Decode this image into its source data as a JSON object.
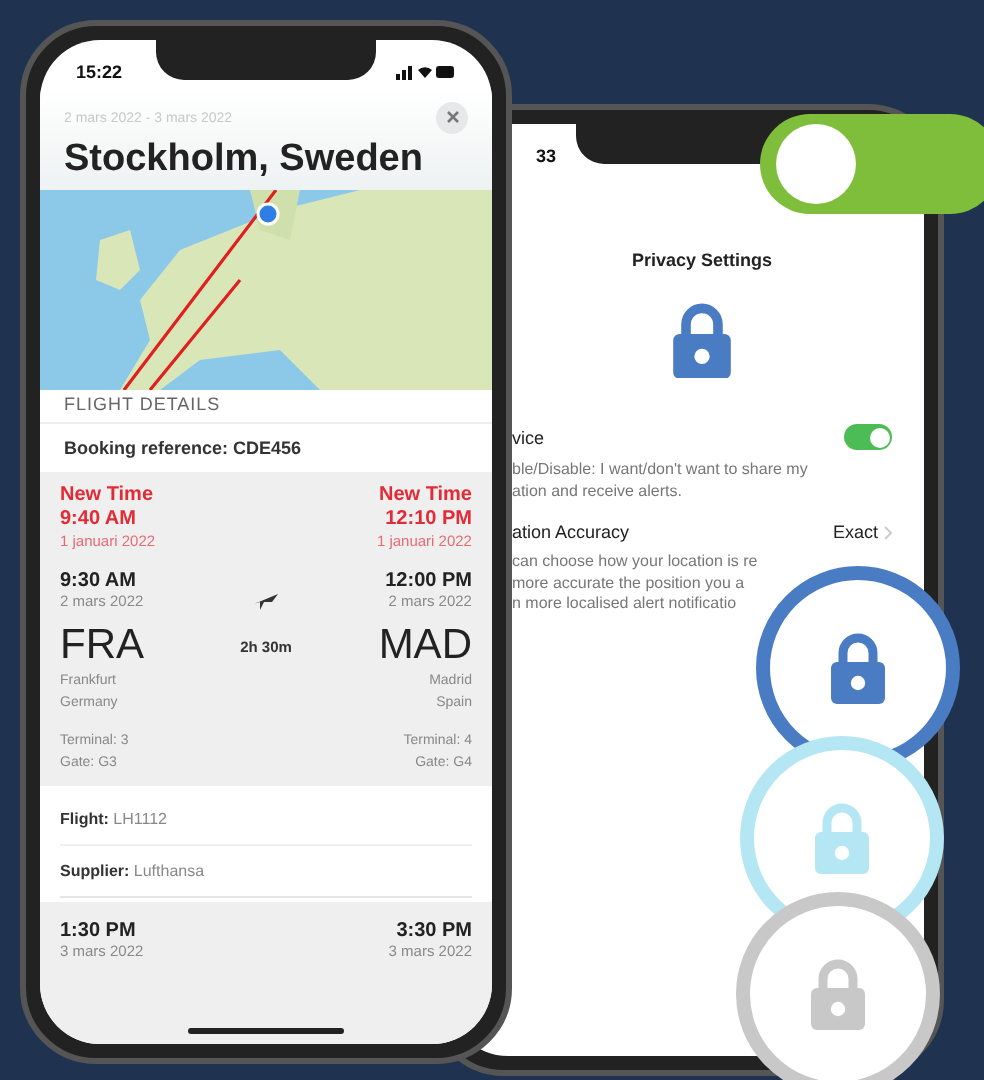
{
  "flight_screen": {
    "status_time": "15:22",
    "date_range": "2 mars 2022 - 3 mars 2022",
    "title": "Stockholm, Sweden",
    "section_title": "FLIGHT DETAILS",
    "booking_reference": "Booking reference: CDE456",
    "departure": {
      "new_time_label": "New Time",
      "new_time": "9:40 AM",
      "new_date": "1 januari 2022",
      "time": "9:30 AM",
      "date": "2 mars 2022",
      "code": "FRA",
      "city": "Frankfurt",
      "country": "Germany",
      "terminal": "Terminal: 3",
      "gate": "Gate: G3"
    },
    "arrival": {
      "new_time_label": "New Time",
      "new_time": "12:10 PM",
      "new_date": "1 januari 2022",
      "time": "12:00 PM",
      "date": "2 mars 2022",
      "code": "MAD",
      "city": "Madrid",
      "country": "Spain",
      "terminal": "Terminal: 4",
      "gate": "Gate: G4"
    },
    "duration": "2h 30m",
    "details": [
      {
        "label": "Flight:",
        "value": "LH1112"
      },
      {
        "label": "Supplier:",
        "value": "Lufthansa"
      }
    ],
    "next_leg": {
      "departure": {
        "time": "1:30 PM",
        "date": "3 mars 2022"
      },
      "arrival": {
        "time": "3:30 PM",
        "date": "3 mars 2022"
      }
    }
  },
  "privacy_screen": {
    "status_time": "33",
    "title": "Privacy Settings",
    "rows": [
      {
        "kind": "toggle",
        "label": "vice",
        "on": true,
        "description": [
          "ble/Disable: I want/don't want to share my",
          "ation and receive alerts."
        ]
      },
      {
        "kind": "value",
        "label": "ation Accuracy",
        "value": "Exact",
        "description": [
          "can choose how your location is re",
          "more accurate the position you a",
          "n more localised alert notificatio"
        ]
      }
    ]
  },
  "big_toggle": {
    "on": true
  },
  "lock_badges": [
    {
      "color": "#4a7cc4"
    },
    {
      "color": "#b5e6f4"
    },
    {
      "color": "#c8c8c8"
    }
  ]
}
